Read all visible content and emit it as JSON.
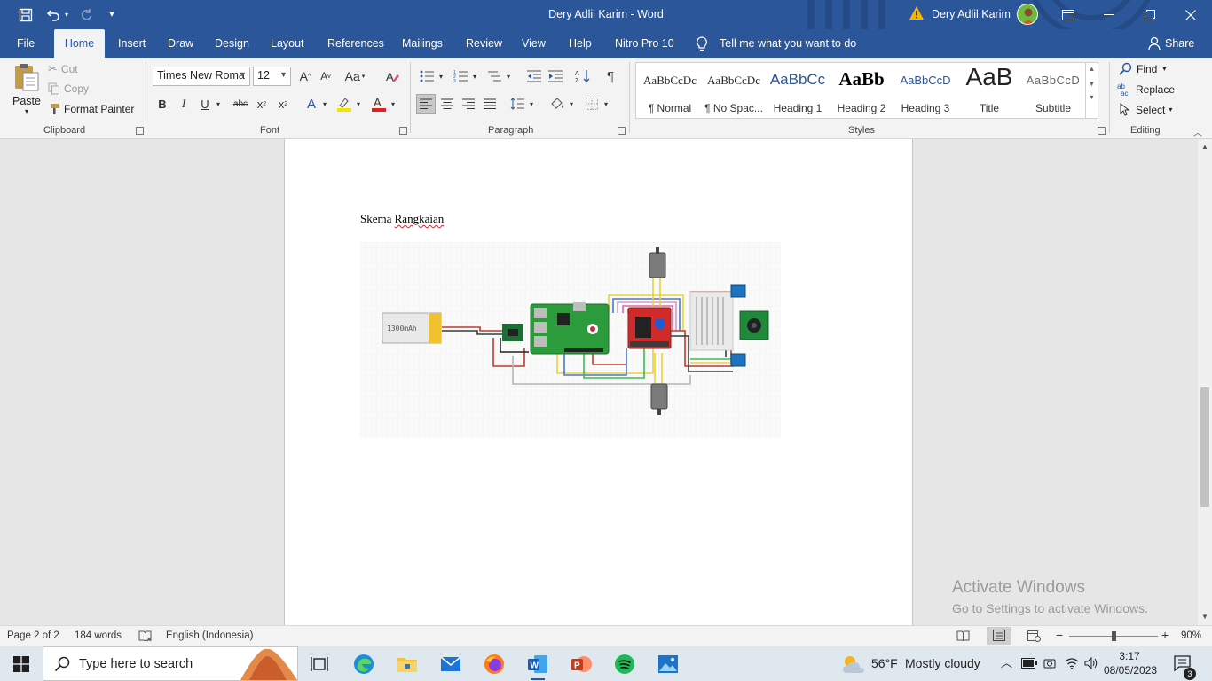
{
  "titlebar": {
    "document_title": "Dery Adlil Karim  -  Word",
    "user_name": "Dery Adlil Karim"
  },
  "tabs": [
    {
      "label": "File"
    },
    {
      "label": "Home"
    },
    {
      "label": "Insert"
    },
    {
      "label": "Draw"
    },
    {
      "label": "Design"
    },
    {
      "label": "Layout"
    },
    {
      "label": "References"
    },
    {
      "label": "Mailings"
    },
    {
      "label": "Review"
    },
    {
      "label": "View"
    },
    {
      "label": "Help"
    },
    {
      "label": "Nitro Pro 10"
    }
  ],
  "tell_me": "Tell me what you want to do",
  "share_label": "Share",
  "clipboard": {
    "paste": "Paste",
    "cut": "Cut",
    "copy": "Copy",
    "format_painter": "Format Painter",
    "group": "Clipboard"
  },
  "font": {
    "family": "Times New Roma",
    "size": "12",
    "group": "Font",
    "case_label": "Aa"
  },
  "paragraph": {
    "group": "Paragraph"
  },
  "styles": {
    "group": "Styles",
    "items": [
      {
        "preview": "AaBbCcDc",
        "name": "¶ Normal"
      },
      {
        "preview": "AaBbCcDc",
        "name": "¶ No Spac..."
      },
      {
        "preview": "AaBbCc",
        "name": "Heading 1"
      },
      {
        "preview": "AaBb",
        "name": "Heading 2"
      },
      {
        "preview": "AaBbCcD",
        "name": "Heading 3"
      },
      {
        "preview": "AaB",
        "name": "Title"
      },
      {
        "preview": "AaBbCcD",
        "name": "Subtitle"
      }
    ]
  },
  "editing": {
    "find": "Find",
    "replace": "Replace",
    "select": "Select",
    "group": "Editing"
  },
  "document": {
    "word1": "Skema",
    "word2": "Rangkaian",
    "battery_label": "1300mAh"
  },
  "watermark": {
    "line1": "Activate Windows",
    "line2": "Go to Settings to activate Windows."
  },
  "status": {
    "page": "Page 2 of 2",
    "words": "184 words",
    "language": "English (Indonesia)",
    "zoom": "90%",
    "zoom_fraction": 0.5
  },
  "taskbar": {
    "search_placeholder": "Type here to search",
    "weather_temp": "56°F",
    "weather_text": "Mostly cloudy",
    "time": "3:17",
    "date": "08/05/2023",
    "notifications": "3"
  },
  "colors": {
    "word_blue": "#2b579a",
    "ribbon_bg": "#f3f3f3",
    "page_bg": "#ffffff"
  }
}
